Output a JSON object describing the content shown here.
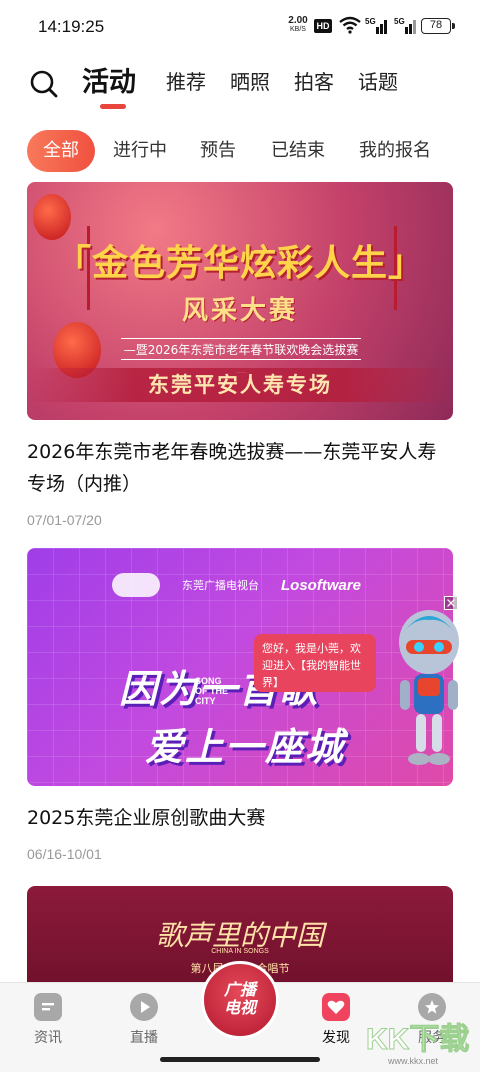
{
  "status_bar": {
    "time": "14:19:25",
    "net_speed_value": "2.00",
    "net_speed_unit": "KB/S",
    "hd_label": "HD",
    "sig1_label": "5G",
    "sig2_label": "5G",
    "battery": "78"
  },
  "top_tabs": [
    {
      "label": "活动",
      "active": true
    },
    {
      "label": "推荐"
    },
    {
      "label": "晒照"
    },
    {
      "label": "拍客"
    },
    {
      "label": "话题"
    }
  ],
  "filters": [
    {
      "label": "全部",
      "active": true
    },
    {
      "label": "进行中"
    },
    {
      "label": "预告"
    },
    {
      "label": "已结束"
    },
    {
      "label": "我的报名"
    }
  ],
  "cards": [
    {
      "banner_line1": "「金色芳华炫彩人生」",
      "banner_line2": "风采大赛",
      "banner_sub": "—暨2026年东莞市老年春节联欢晚会选拔赛—",
      "banner_ribbon": "东莞平安人寿专场",
      "title": "2026年东莞市老年春晚选拔赛——东莞平安人寿专场（内推）",
      "date": "07/01-07/20"
    },
    {
      "logo_b": "东莞广播电视台",
      "logo_c": "Losoftware",
      "banner_line1": "因为一首歌",
      "banner_line2": "爱上一座城",
      "song_label": "SONG OF THE CITY",
      "title": "2025东莞企业原创歌曲大赛",
      "date": "06/16-10/01"
    },
    {
      "banner_calligraphy": "歌声里的中国",
      "banner_en": "CHINA IN SONGS",
      "banner_fest": "第八届东莞市合唱节"
    }
  ],
  "assistant": {
    "message": "您好，我是小莞，欢迎进入【我的智能世界】"
  },
  "bottom_nav": [
    {
      "label": "资讯",
      "icon": "news-icon"
    },
    {
      "label": "直播",
      "icon": "play-icon"
    },
    {
      "label": "广播电视",
      "icon": "broadcast-tv-icon"
    },
    {
      "label": "发现",
      "icon": "heart-icon",
      "active": true
    },
    {
      "label": "服务",
      "icon": "star-icon"
    }
  ],
  "watermark": {
    "brand": "KK下载",
    "url": "www.kkx.net"
  },
  "colors": {
    "accent": "#e8453c",
    "chip_active_start": "#f8795a",
    "chip_active_end": "#f0513f",
    "nav_active": "#f0445e"
  }
}
